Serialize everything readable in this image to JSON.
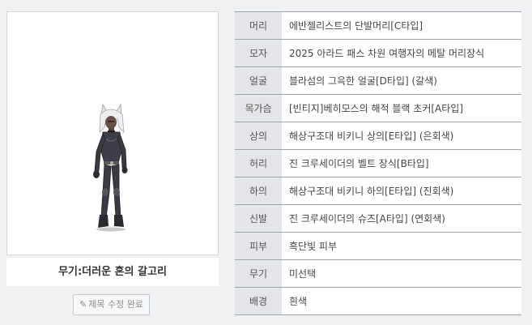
{
  "preview": {
    "caption": "무기:더러운 혼의 갈고리",
    "edit_button_label": "제목 수정 완료"
  },
  "equipment": [
    {
      "slot": "머리",
      "item": "에반젤리스트의 단발머리[C타입]"
    },
    {
      "slot": "모자",
      "item": "2025 아라드 패스 차원 여행자의 메탈 머리장식"
    },
    {
      "slot": "얼굴",
      "item": "블라섬의 그윽한 얼굴[D타입] (갈색)"
    },
    {
      "slot": "목가슴",
      "item": "[빈티지]베히모스의 해적 블랙 초커[A타입]"
    },
    {
      "slot": "상의",
      "item": "해상구조대 비키니 상의[E타입] (은회색)"
    },
    {
      "slot": "허리",
      "item": "진 크루세이더의 벨트 장식[B타입]"
    },
    {
      "slot": "하의",
      "item": "해상구조대 비키니 하의[E타입] (진회색)"
    },
    {
      "slot": "신발",
      "item": "진 크루세이더의 슈즈[A타입] (연회색)"
    },
    {
      "slot": "피부",
      "item": "흑단빛 피부"
    },
    {
      "slot": "무기",
      "item": "미선택"
    },
    {
      "slot": "배경",
      "item": "흰색"
    }
  ]
}
